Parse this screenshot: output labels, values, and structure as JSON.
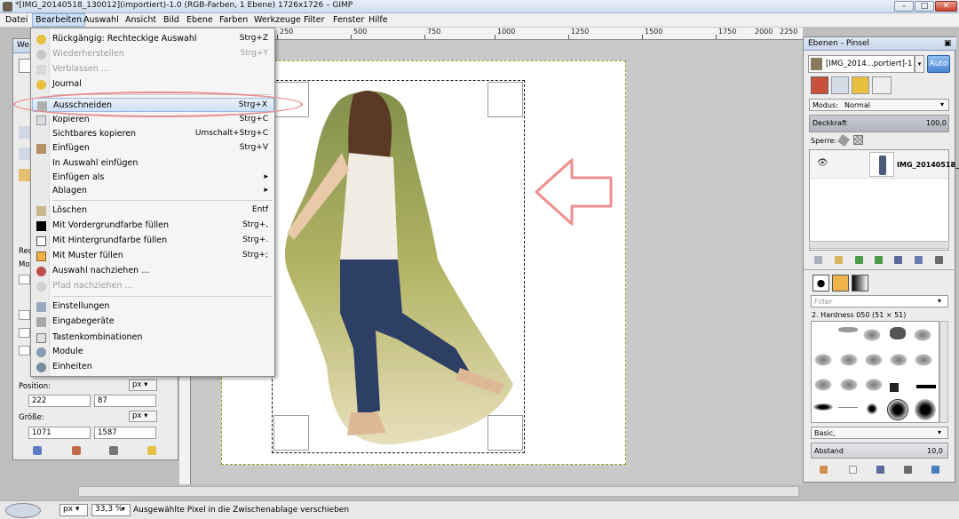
{
  "window": {
    "title": "*[IMG_20140518_130012](importiert)-1.0 (RGB-Farben, 1 Ebene) 1726x1726 – GIMP"
  },
  "menubar": [
    "Datei",
    "Bearbeiten",
    "Auswahl",
    "Ansicht",
    "Bild",
    "Ebene",
    "Farben",
    "Werkzeuge",
    "Filter",
    "Fenster",
    "Hilfe"
  ],
  "edit_menu": {
    "items": [
      {
        "label": "Rückgängig: Rechteckige Auswahl",
        "shortcut": "Strg+Z",
        "disabled": false,
        "icon": "undo-icon"
      },
      {
        "label": "Wiederherstellen",
        "shortcut": "Strg+Y",
        "disabled": true,
        "icon": "redo-icon"
      },
      {
        "label": "Verblassen ...",
        "shortcut": "",
        "disabled": true,
        "icon": "fade-icon"
      },
      {
        "label": "Journal",
        "shortcut": "",
        "disabled": false,
        "icon": "journal-icon"
      },
      {
        "label": "Ausschneiden",
        "shortcut": "Strg+X",
        "disabled": false,
        "icon": "cut-icon",
        "highlighted": true
      },
      {
        "label": "Kopieren",
        "shortcut": "Strg+C",
        "disabled": false,
        "icon": "copy-icon"
      },
      {
        "label": "Sichtbares kopieren",
        "shortcut": "Umschalt+Strg+C",
        "disabled": false,
        "icon": ""
      },
      {
        "label": "Einfügen",
        "shortcut": "Strg+V",
        "disabled": false,
        "icon": "paste-icon"
      },
      {
        "label": "In Auswahl einfügen",
        "shortcut": "",
        "disabled": false,
        "icon": ""
      },
      {
        "label": "Einfügen als",
        "shortcut": "",
        "disabled": false,
        "icon": "",
        "submenu": true
      },
      {
        "label": "Ablagen",
        "shortcut": "",
        "disabled": false,
        "icon": "",
        "submenu": true
      },
      {
        "label": "Löschen",
        "shortcut": "Entf",
        "disabled": false,
        "icon": "clear-icon"
      },
      {
        "label": "Mit Vordergrundfarbe füllen",
        "shortcut": "Strg+,",
        "disabled": false,
        "icon": "fill-fg-icon"
      },
      {
        "label": "Mit Hintergrundfarbe füllen",
        "shortcut": "Strg+.",
        "disabled": false,
        "icon": "fill-bg-icon"
      },
      {
        "label": "Mit Muster füllen",
        "shortcut": "Strg+;",
        "disabled": false,
        "icon": "fill-pattern-icon"
      },
      {
        "label": "Auswahl nachziehen ...",
        "shortcut": "",
        "disabled": false,
        "icon": "stroke-selection-icon"
      },
      {
        "label": "Pfad nachziehen ...",
        "shortcut": "",
        "disabled": true,
        "icon": "stroke-path-icon"
      },
      {
        "label": "Einstellungen",
        "shortcut": "",
        "disabled": false,
        "icon": "preferences-icon"
      },
      {
        "label": "Eingabegeräte",
        "shortcut": "",
        "disabled": false,
        "icon": "input-devices-icon"
      },
      {
        "label": "Tastenkombinationen",
        "shortcut": "",
        "disabled": false,
        "icon": "keyboard-icon"
      },
      {
        "label": "Module",
        "shortcut": "",
        "disabled": false,
        "icon": "modules-icon"
      },
      {
        "label": "Einheiten",
        "shortcut": "",
        "disabled": false,
        "icon": "units-icon"
      }
    ]
  },
  "rulers": {
    "top": [
      "250",
      "500",
      "750",
      "1000",
      "1250",
      "1500",
      "1750",
      "2000",
      "2250"
    ]
  },
  "toolbox": {
    "title": "We",
    "tool_label": "Rec",
    "mode_label": "Mo",
    "position_label": "Position:",
    "position_unit": "px",
    "position_x": "222",
    "position_y": "87",
    "size_label": "Größe:",
    "size_unit": "px",
    "size_w": "1071",
    "size_h": "1587"
  },
  "layers_panel": {
    "title": "Ebenen - Pinsel",
    "image_selector": "[IMG_2014...portiert]-1",
    "auto_button": "Auto",
    "mode_label": "Modus:",
    "mode_value": "Normal",
    "opacity_label": "Deckkraft",
    "opacity_value": "100,0",
    "lock_label": "Sperre:",
    "layer_name": "IMG_20140518_",
    "brush_filter_placeholder": "Filter",
    "brush_name": "2. Hardness 050 (51 × 51)",
    "brush_tag": "Basic,",
    "spacing_label": "Abstand",
    "spacing_value": "10,0"
  },
  "status": {
    "unit": "px",
    "zoom": "33,3 %",
    "message": "Ausgewählte Pixel in die Zwischenablage verschieben"
  }
}
